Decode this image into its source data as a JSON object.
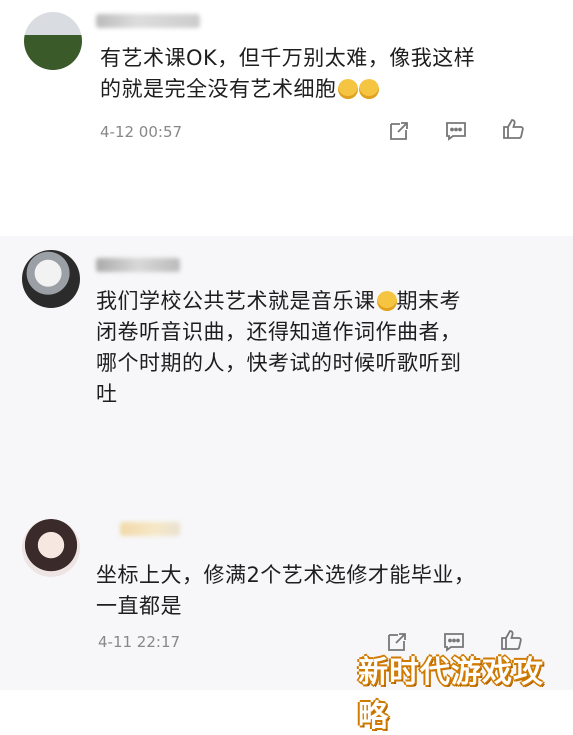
{
  "comments": [
    {
      "text_line1": "有艺术课OK，但千万别太难，像我这样",
      "text_line2": "的就是完全没有艺术细胞",
      "time": "4-12 00:57"
    },
    {
      "text_line1": "我们学校公共艺术就是音乐课",
      "text_line1b": "期末考",
      "text_line2": "闭卷听音识曲，还得知道作词作曲者，",
      "text_line3": "哪个时期的人，快考试的时候听歌听到",
      "text_line4": "吐"
    },
    {
      "text_line1": "坐标上大，修满2个艺术选修才能毕业，",
      "text_line2": "一直都是",
      "time": "4-11 22:17"
    }
  ],
  "watermark": "新时代游戏攻略",
  "colors": {
    "time": "#888888",
    "icon": "#777777",
    "watermark_outline": "#d07a00"
  },
  "icons": [
    "share-icon",
    "comment-icon",
    "like-icon"
  ]
}
